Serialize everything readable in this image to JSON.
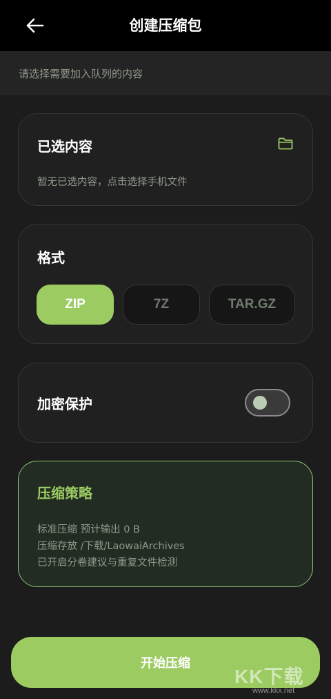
{
  "header": {
    "title": "创建压缩包",
    "back_icon": "arrow-left-icon"
  },
  "subheader": {
    "text": "请选择需要加入队列的内容"
  },
  "selected_content": {
    "title": "已选内容",
    "empty_hint": "暂无已选内容，点击选择手机文件",
    "icon": "folder-icon"
  },
  "format": {
    "title": "格式",
    "options": [
      "ZIP",
      "7Z",
      "TAR.GZ"
    ],
    "selected": "ZIP"
  },
  "encryption": {
    "title": "加密保护",
    "enabled": false
  },
  "strategy": {
    "title": "压缩策略",
    "lines": [
      "标准压缩  预计输出 0 B",
      "压缩存放 /下载/LaowaiArchives",
      "已开启分卷建议与重复文件检测"
    ]
  },
  "actions": {
    "start_label": "开始压缩"
  },
  "watermark": {
    "text": "KK下载",
    "url": "www.kkx.net"
  },
  "colors": {
    "accent": "#9ccb62",
    "background": "#1c1c1c",
    "card": "#202020",
    "strategy_border": "#8fc27a"
  }
}
